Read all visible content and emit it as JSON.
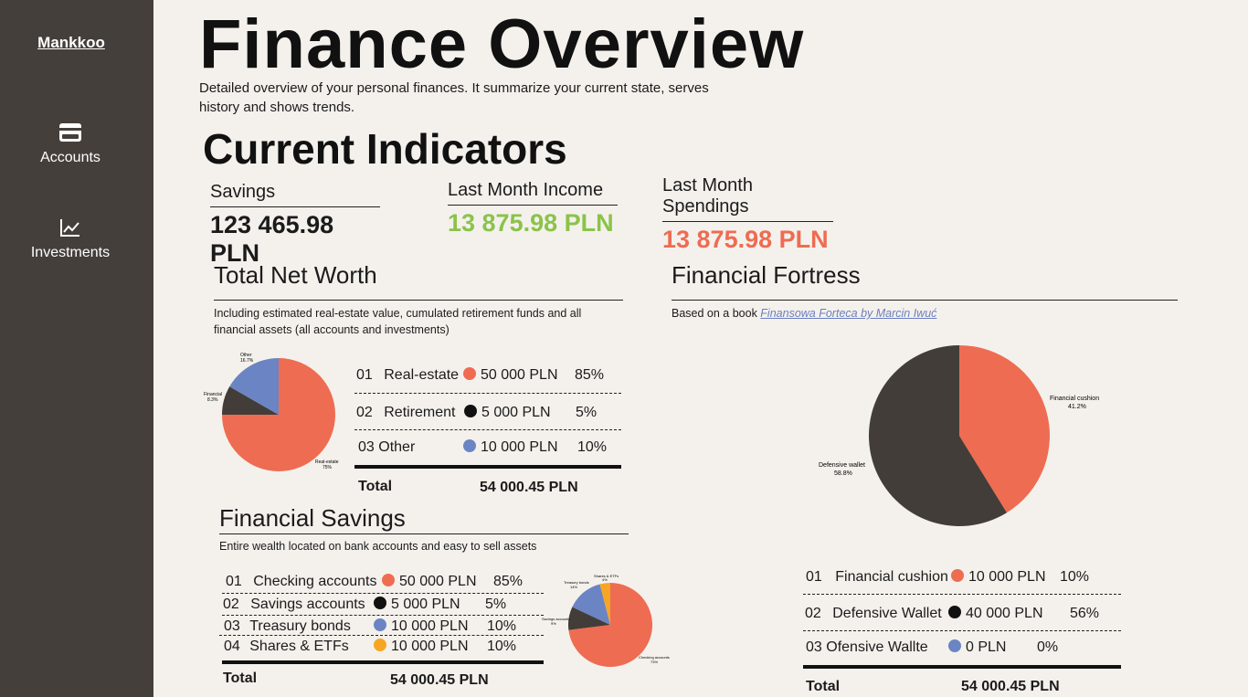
{
  "sidebar": {
    "brand": "Mankkoo",
    "items": [
      {
        "label": "Accounts",
        "icon": "credit-card-icon"
      },
      {
        "label": "Investments",
        "icon": "chart-line-icon"
      }
    ]
  },
  "header": {
    "title": "Finance Overview",
    "description": "Detailed overview of your personal finances. It summarize your current state, serves history and shows trends."
  },
  "indicators": {
    "title": "Current Indicators",
    "savings": {
      "label": "Savings",
      "value": "123 465.98 PLN"
    },
    "income": {
      "label": "Last Month Income",
      "value": "13 875.98 PLN",
      "color": "#8bc34a"
    },
    "spendings": {
      "label": "Last Month Spendings",
      "value": "13 875.98 PLN",
      "color": "#ee6c52"
    }
  },
  "colors": {
    "orange": "#ee6c52",
    "dark": "#433d39",
    "blue": "#6b84c4",
    "yellow": "#f6a623",
    "black": "#111111"
  },
  "net_worth": {
    "title": "Total Net Worth",
    "subtitle": "Including estimated real-estate value, cumulated retirement funds and all financial assets (all accounts and investments)",
    "rows": [
      {
        "num": "01",
        "name": "Real-estate",
        "amount": "50 000 PLN",
        "pct": "85%",
        "color": "orange"
      },
      {
        "num": "02",
        "name": "Retirement",
        "amount": "5 000 PLN",
        "pct": "5%",
        "color": "black"
      },
      {
        "num": "03",
        "name": "Other",
        "amount": "10 000 PLN",
        "pct": "10%",
        "color": "blue"
      }
    ],
    "total_label": "Total",
    "total_value": "54 000.45 PLN"
  },
  "fortress": {
    "title": "Financial Fortress",
    "subtitle_prefix": "Based on a book ",
    "subtitle_link": "Finansowa Forteca by Marcin Iwuć",
    "rows": [
      {
        "num": "01",
        "name": "Financial cushion",
        "amount": "10 000 PLN",
        "pct": "10%",
        "color": "orange"
      },
      {
        "num": "02",
        "name": "Defensive Wallet",
        "amount": "40 000 PLN",
        "pct": "56%",
        "color": "black"
      },
      {
        "num": "03",
        "name": "Ofensive Wallte",
        "amount": "0 PLN",
        "pct": "0%",
        "color": "blue"
      }
    ],
    "total_label": "Total",
    "total_value": "54 000.45 PLN"
  },
  "savings": {
    "title": "Financial Savings",
    "subtitle": "Entire wealth located on bank accounts and easy to sell assets",
    "rows": [
      {
        "num": "01",
        "name": "Checking accounts",
        "amount": "50 000 PLN",
        "pct": "85%",
        "color": "orange"
      },
      {
        "num": "02",
        "name": "Savings accounts",
        "amount": "5 000 PLN",
        "pct": "5%",
        "color": "black"
      },
      {
        "num": "03",
        "name": "Treasury bonds",
        "amount": "10 000 PLN",
        "pct": "10%",
        "color": "blue"
      },
      {
        "num": "04",
        "name": "Shares & ETFs",
        "amount": "10 000 PLN",
        "pct": "10%",
        "color": "yellow"
      }
    ],
    "total_label": "Total",
    "total_value": "54 000.45 PLN"
  },
  "chart_data": [
    {
      "type": "pie",
      "slices": [
        {
          "label": "Real-estate",
          "value": 75.0,
          "pct_label": "75%",
          "color": "#ee6c52"
        },
        {
          "label": "Financial",
          "value": 8.3,
          "pct_label": "8.3%",
          "color": "#433d39"
        },
        {
          "label": "Other",
          "value": 16.7,
          "pct_label": "16.7%",
          "color": "#6b84c4"
        }
      ]
    },
    {
      "type": "pie",
      "slices": [
        {
          "label": "Financial cushion",
          "value": 41.2,
          "pct_label": "41.2%",
          "color": "#ee6c52"
        },
        {
          "label": "Defensive wallet",
          "value": 58.8,
          "pct_label": "58.8%",
          "color": "#433d39"
        }
      ]
    },
    {
      "type": "pie",
      "slices": [
        {
          "label": "Checking accounts",
          "value": 73,
          "pct_label": "73%",
          "color": "#ee6c52"
        },
        {
          "label": "Savings accounts",
          "value": 9,
          "pct_label": "9%",
          "color": "#433d39"
        },
        {
          "label": "Treasury bonds",
          "value": 14,
          "pct_label": "14%",
          "color": "#6b84c4"
        },
        {
          "label": "Shares & ETFs",
          "value": 4,
          "pct_label": "4%",
          "color": "#f6a623"
        }
      ]
    }
  ]
}
